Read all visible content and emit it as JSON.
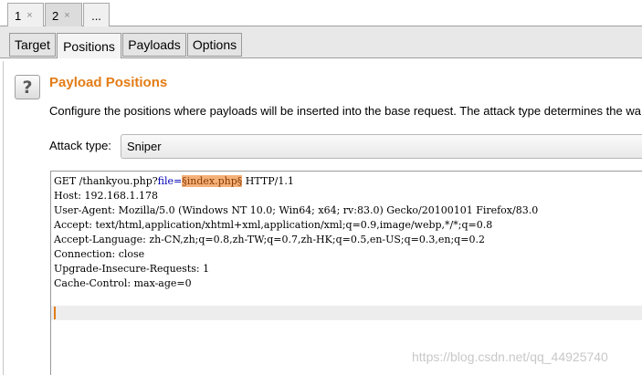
{
  "top_tabs": [
    {
      "label": "1",
      "close": "×"
    },
    {
      "label": "2",
      "close": "×"
    },
    {
      "label": "..."
    }
  ],
  "sub_tabs": [
    "Target",
    "Positions",
    "Payloads",
    "Options"
  ],
  "panel": {
    "help_glyph": "?",
    "title": "Payload Positions",
    "description": "Configure the positions where payloads will be inserted into the base request. The attack type determines the wa",
    "attack_type_label": "Attack type:",
    "attack_type_value": "Sniper"
  },
  "request": {
    "line1": {
      "method": "GET /thankyou.php?",
      "param": "file",
      "eq": "=",
      "payload": "§index.php§",
      "rest": " HTTP/1.1"
    },
    "lines": [
      "Host: 192.168.1.178",
      "User-Agent: Mozilla/5.0 (Windows NT 10.0; Win64; x64; rv:83.0) Gecko/20100101 Firefox/83.0",
      "Accept: text/html,application/xhtml+xml,application/xml;q=0.9,image/webp,*/*;q=0.8",
      "Accept-Language: zh-CN,zh;q=0.8,zh-TW;q=0.7,zh-HK;q=0.5,en-US;q=0.3,en;q=0.2",
      "Connection: close",
      "Upgrade-Insecure-Requests: 1",
      "Cache-Control: max-age=0"
    ]
  },
  "watermark": "https://blog.csdn.net/qq_44925740"
}
